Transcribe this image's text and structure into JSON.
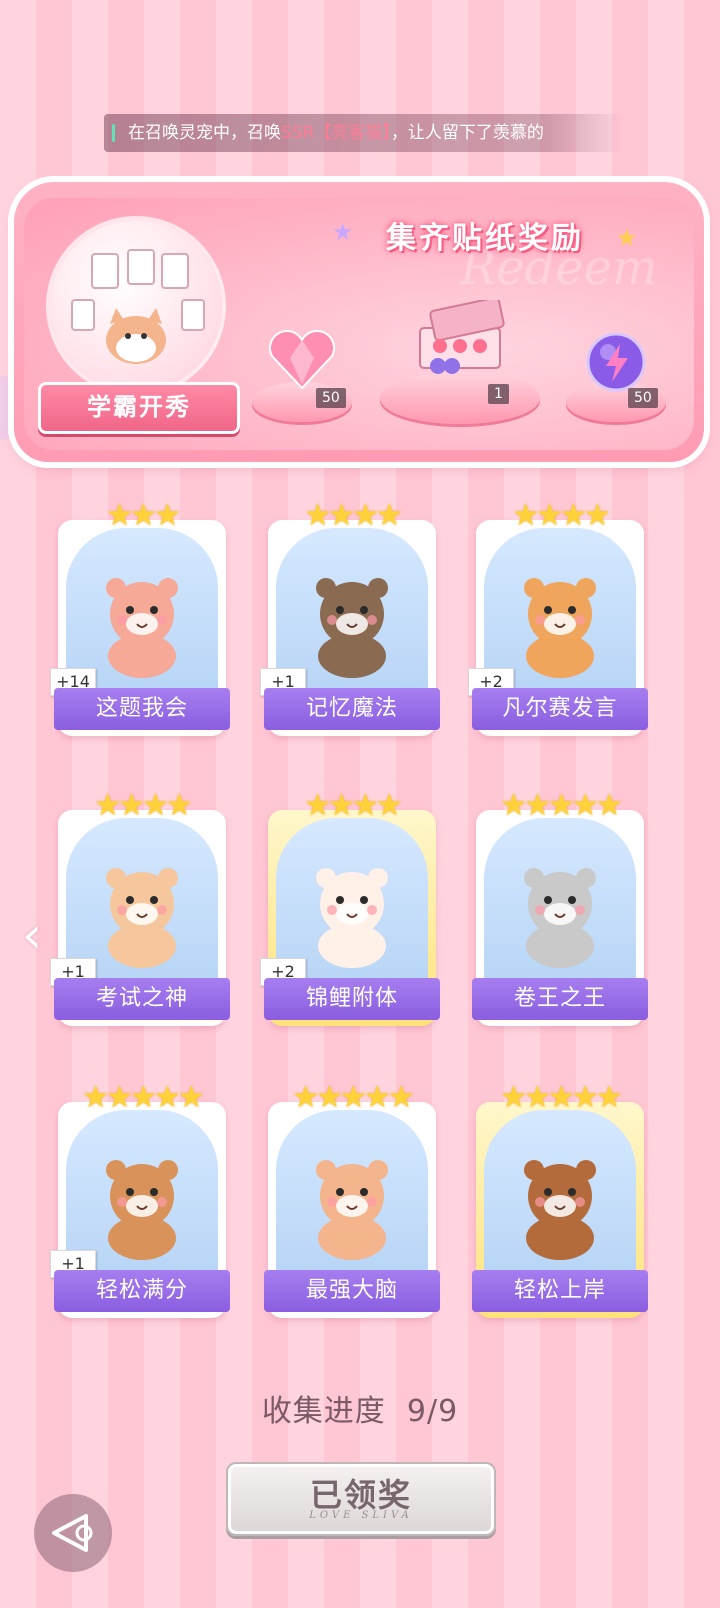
{
  "ticker": {
    "prefix": "在召唤灵宠中，召唤",
    "highlight": "SSR【亮客猫】",
    "suffix": "，让人留下了羡慕的"
  },
  "banner": {
    "title": "集齐贴纸奖励",
    "watermark": "Redeem",
    "showcase_label": "学霸开秀",
    "rewards": [
      {
        "icon": "pink-heart-gem-icon",
        "count": "50"
      },
      {
        "icon": "gift-box-icon",
        "count": "1"
      },
      {
        "icon": "purple-lightning-orb-icon",
        "count": "50"
      }
    ]
  },
  "cards": [
    {
      "name": "这题我会",
      "stars": 3,
      "count": "+14",
      "animal": "bear-at-desk"
    },
    {
      "name": "记忆魔法",
      "stars": 4,
      "count": "+1",
      "animal": "otter-wizard"
    },
    {
      "name": "凡尔赛发言",
      "stars": 4,
      "count": "+2",
      "animal": "lion-microphone"
    },
    {
      "name": "考试之神",
      "stars": 4,
      "count": "+1",
      "animal": "angel-cat"
    },
    {
      "name": "锦鲤附体",
      "stars": 4,
      "count": "+2",
      "animal": "bear-koi"
    },
    {
      "name": "卷王之王",
      "stars": 5,
      "count": "",
      "animal": "studying-cat"
    },
    {
      "name": "轻松满分",
      "stars": 5,
      "count": "+1",
      "animal": "puppy-full-score"
    },
    {
      "name": "最强大脑",
      "stars": 5,
      "count": "",
      "animal": "cat-papers"
    },
    {
      "name": "轻松上岸",
      "stars": 5,
      "count": "",
      "animal": "squirrel-graduate"
    }
  ],
  "progress": {
    "label": "收集进度",
    "value": "9/9"
  },
  "claim_button": {
    "label": "已领奖",
    "subtitle": "LOVE SLIVA"
  },
  "colors": {
    "label_purple": "#8a5ee0",
    "star_gold": "#ffd23a",
    "pink_bg": "#ffd4df"
  }
}
